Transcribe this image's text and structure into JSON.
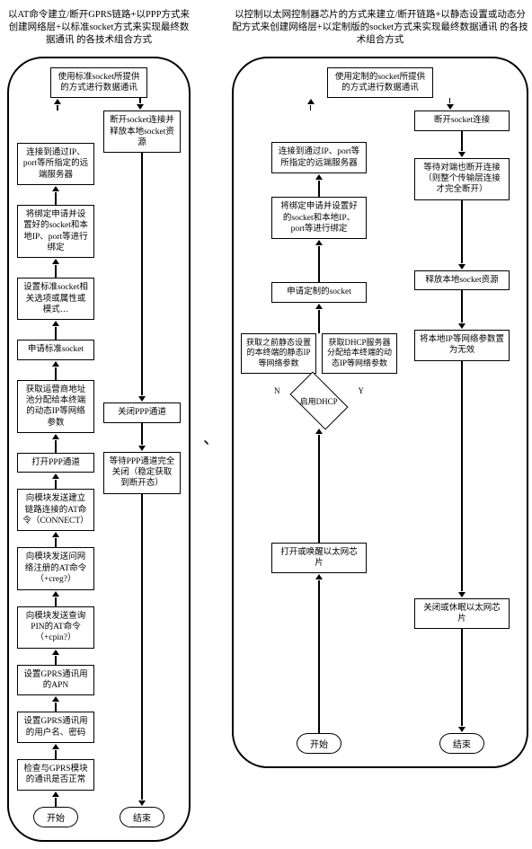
{
  "left": {
    "header": "以AT命令建立/断开GPRS链路+以PPP方式来创建网络层+以标准socket方式来实现最终数据通讯 的各技术组合方式",
    "start": "开始",
    "end": "结束",
    "up": [
      "检查与GPRS模块的通讯是否正常",
      "设置GPRS通讯用的用户名、密码",
      "设置GPRS通讯用的APN",
      "向模块发送查询PIN的AT命令（+cpin?）",
      "向模块发送问网络注册的AT命令（+creg?）",
      "向模块发送建立链路连接的AT命令（CONNECT）",
      "打开PPP通道",
      "获取运营商地址池分配给本终端的动态IP等网络参数",
      "申请标准socket",
      "设置标准socket相关选项或属性或模式…",
      "将绑定申请并设置好的socket和本地IP、port等进行绑定",
      "连接到通过IP、port等所指定的远端服务器"
    ],
    "top": "使用标准socket所提供的方式进行数据通讯",
    "down": [
      "断开socket连接并释放本地socket资源",
      "关闭PPP通道",
      "等待PPP通道完全关闭（稳定获取到断开态）"
    ]
  },
  "right": {
    "header": "以控制以太网控制器芯片的方式来建立/断开链路+以静态设置或动态分配方式来创建网络层+以定制版的socket方式来实现最终数据通讯 的各技术组合方式",
    "start": "开始",
    "end": "结束",
    "up": [
      "打开或唤醒以太网芯片"
    ],
    "dhcp_label": "启用DHCP",
    "dhcp_n": "N",
    "dhcp_y": "Y",
    "branch_n": "获取之前静态设置的本终端的静态IP等网络参数",
    "branch_y": "获取DHCP服务器分配给本终端的动态IP等网络参数",
    "up2": [
      "申请定制的socket",
      "将绑定申请并设置好的socket和本地IP、port等进行绑定",
      "连接到通过IP、port等所指定的远端服务器"
    ],
    "top": "使用定制的socket所提供的方式进行数据通讯",
    "down": [
      "断开socket连接",
      "等待对端也断开连接（则整个传输层连接才完全断开）",
      "释放本地socket资源",
      "将本地IP等网络参数置为无效",
      "关闭或休眠以太网芯片"
    ]
  },
  "sep_left": "、",
  "sep_right": "、……"
}
